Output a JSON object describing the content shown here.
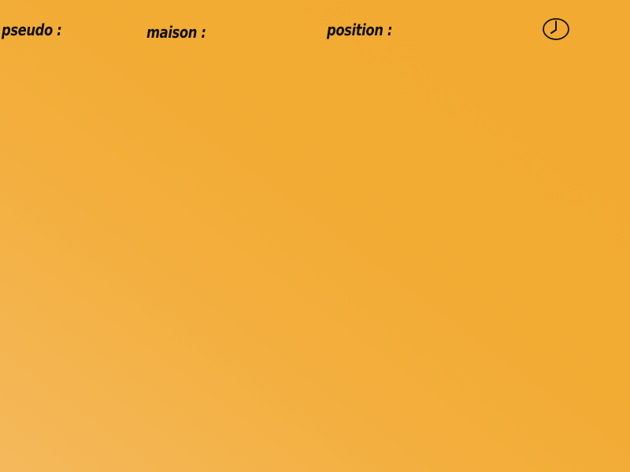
{
  "header": {
    "pseudo_label": "pseudo :",
    "maison_label": "maison :",
    "position_label": "position :",
    "clock_icon": "clock-icon"
  },
  "colors": {
    "background": "#f2aa32",
    "background_light": "#f5b95c",
    "text": "#111111"
  }
}
